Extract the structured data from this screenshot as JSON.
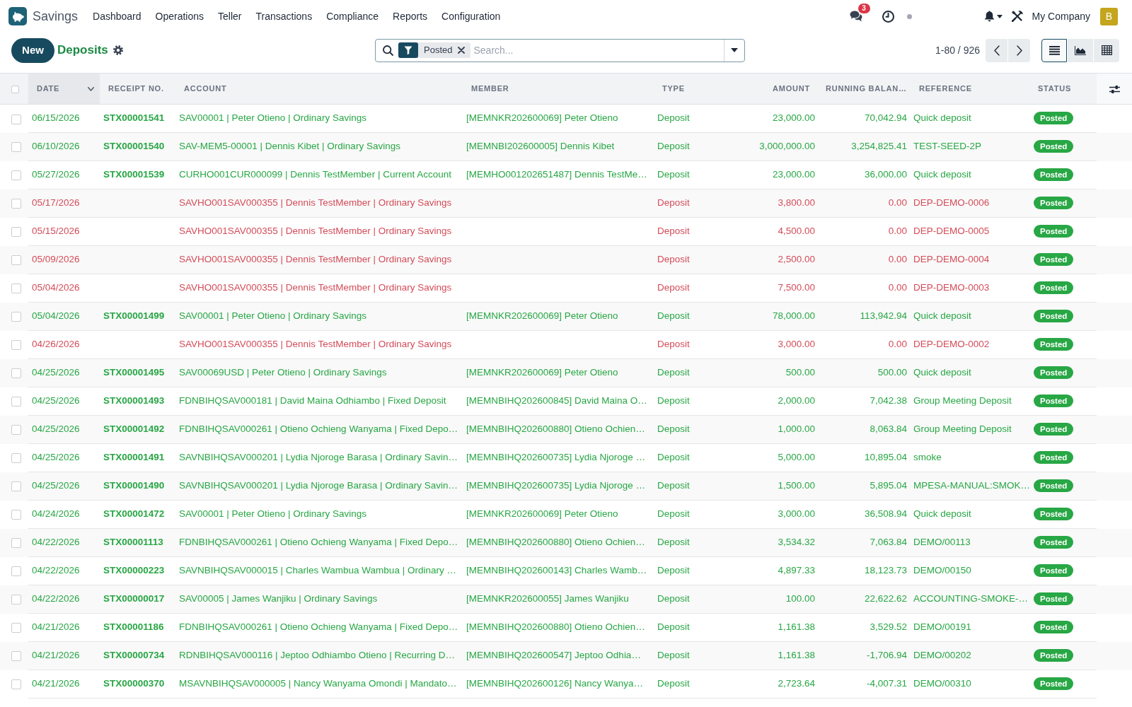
{
  "navbar": {
    "app_name": "Savings",
    "menu": [
      "Dashboard",
      "Operations",
      "Teller",
      "Transactions",
      "Compliance",
      "Reports",
      "Configuration"
    ],
    "messages_count": "3",
    "company": "My Company",
    "avatar_letter": "B"
  },
  "control_panel": {
    "new_button": "New",
    "breadcrumb": "Deposits",
    "search": {
      "facets": [
        {
          "label": "Posted"
        }
      ],
      "placeholder": "Search..."
    },
    "pager": "1-80 / 926",
    "views": [
      {
        "kind": "list",
        "selected": true
      },
      {
        "kind": "graph",
        "selected": false
      },
      {
        "kind": "pivot",
        "selected": false
      }
    ]
  },
  "table": {
    "select_all": {
      "checked": false
    },
    "columns": [
      {
        "label": "DATE",
        "sorted": true
      },
      {
        "label": "RECEIPT NO.",
        "sorted": false
      },
      {
        "label": "ACCOUNT",
        "sorted": false
      },
      {
        "label": "MEMBER",
        "sorted": false
      },
      {
        "label": "TYPE",
        "sorted": false
      },
      {
        "label": "AMOUNT",
        "sorted": false
      },
      {
        "label": "RUNNING BALAN…",
        "sorted": false
      },
      {
        "label": "REFERENCE",
        "sorted": false
      },
      {
        "label": "STATUS",
        "sorted": false
      }
    ],
    "rows": [
      {
        "selected": false,
        "color": "#28a745",
        "date": "06/15/2026",
        "receipt_no": "STX00001541",
        "account": "SAV00001 | Peter Otieno | Ordinary Savings",
        "member": "[MEMNKR202600069] Peter Otieno",
        "type": "Deposit",
        "amount": "23,000.00",
        "running_balance": "70,042.94",
        "reference": "Quick deposit",
        "status": "Posted"
      },
      {
        "selected": false,
        "color": "#28a745",
        "date": "06/10/2026",
        "receipt_no": "STX00001540",
        "account": "SAV-MEM5-00001 | Dennis Kibet | Ordinary Savings",
        "member": "[MEMNBI202600005] Dennis Kibet",
        "type": "Deposit",
        "amount": "3,000,000.00",
        "running_balance": "3,254,825.41",
        "reference": "TEST-SEED-2P",
        "status": "Posted"
      },
      {
        "selected": false,
        "color": "#28a745",
        "date": "05/27/2026",
        "receipt_no": "STX00001539",
        "account": "CURHO001CUR000099 | Dennis TestMember | Current Account",
        "member": "[MEMHO001202651487] Dennis TestMe…",
        "type": "Deposit",
        "amount": "23,000.00",
        "running_balance": "36,000.00",
        "reference": "Quick deposit",
        "status": "Posted"
      },
      {
        "selected": false,
        "color": "#d44c59",
        "date": "05/17/2026",
        "account": "SAVHO001SAV000355 | Dennis TestMember | Ordinary Savings",
        "type": "Deposit",
        "amount": "3,800.00",
        "running_balance": "0.00",
        "reference": "DEP-DEMO-0006",
        "status": "Posted"
      },
      {
        "selected": false,
        "color": "#d44c59",
        "date": "05/15/2026",
        "account": "SAVHO001SAV000355 | Dennis TestMember | Ordinary Savings",
        "type": "Deposit",
        "amount": "4,500.00",
        "running_balance": "0.00",
        "reference": "DEP-DEMO-0005",
        "status": "Posted"
      },
      {
        "selected": false,
        "color": "#d44c59",
        "date": "05/09/2026",
        "account": "SAVHO001SAV000355 | Dennis TestMember | Ordinary Savings",
        "type": "Deposit",
        "amount": "2,500.00",
        "running_balance": "0.00",
        "reference": "DEP-DEMO-0004",
        "status": "Posted"
      },
      {
        "selected": false,
        "color": "#d44c59",
        "date": "05/04/2026",
        "account": "SAVHO001SAV000355 | Dennis TestMember | Ordinary Savings",
        "type": "Deposit",
        "amount": "7,500.00",
        "running_balance": "0.00",
        "reference": "DEP-DEMO-0003",
        "status": "Posted"
      },
      {
        "selected": false,
        "color": "#28a745",
        "date": "05/04/2026",
        "receipt_no": "STX00001499",
        "account": "SAV00001 | Peter Otieno | Ordinary Savings",
        "member": "[MEMNKR202600069] Peter Otieno",
        "type": "Deposit",
        "amount": "78,000.00",
        "running_balance": "113,942.94",
        "reference": "Quick deposit",
        "status": "Posted"
      },
      {
        "selected": false,
        "color": "#d44c59",
        "date": "04/26/2026",
        "account": "SAVHO001SAV000355 | Dennis TestMember | Ordinary Savings",
        "type": "Deposit",
        "amount": "3,000.00",
        "running_balance": "0.00",
        "reference": "DEP-DEMO-0002",
        "status": "Posted"
      },
      {
        "selected": false,
        "color": "#28a745",
        "date": "04/25/2026",
        "receipt_no": "STX00001495",
        "account": "SAV00069USD | Peter Otieno | Ordinary Savings",
        "member": "[MEMNKR202600069] Peter Otieno",
        "type": "Deposit",
        "amount": "500.00",
        "running_balance": "500.00",
        "reference": "Quick deposit",
        "status": "Posted"
      },
      {
        "selected": false,
        "color": "#28a745",
        "date": "04/25/2026",
        "receipt_no": "STX00001493",
        "account": "FDNBIHQSAV000181 | David Maina Odhiambo | Fixed Deposit",
        "member": "[MEMNBIHQ202600845] David Maina O…",
        "type": "Deposit",
        "amount": "2,000.00",
        "running_balance": "7,042.38",
        "reference": "Group Meeting Deposit",
        "status": "Posted"
      },
      {
        "selected": false,
        "color": "#28a745",
        "date": "04/25/2026",
        "receipt_no": "STX00001492",
        "account": "FDNBIHQSAV000261 | Otieno Ochieng Wanyama | Fixed Depo…",
        "member": "[MEMNBIHQ202600880] Otieno Ochien…",
        "type": "Deposit",
        "amount": "1,000.00",
        "running_balance": "8,063.84",
        "reference": "Group Meeting Deposit",
        "status": "Posted"
      },
      {
        "selected": false,
        "color": "#28a745",
        "date": "04/25/2026",
        "receipt_no": "STX00001491",
        "account": "SAVNBIHQSAV000201 | Lydia Njoroge Barasa | Ordinary Savin…",
        "member": "[MEMNBIHQ202600735] Lydia Njoroge …",
        "type": "Deposit",
        "amount": "5,000.00",
        "running_balance": "10,895.04",
        "reference": "smoke",
        "status": "Posted"
      },
      {
        "selected": false,
        "color": "#28a745",
        "date": "04/25/2026",
        "receipt_no": "STX00001490",
        "account": "SAVNBIHQSAV000201 | Lydia Njoroge Barasa | Ordinary Savin…",
        "member": "[MEMNBIHQ202600735] Lydia Njoroge …",
        "type": "Deposit",
        "amount": "1,500.00",
        "running_balance": "5,895.04",
        "reference": "MPESA-MANUAL:SMOK…",
        "status": "Posted"
      },
      {
        "selected": false,
        "color": "#28a745",
        "date": "04/24/2026",
        "receipt_no": "STX00001472",
        "account": "SAV00001 | Peter Otieno | Ordinary Savings",
        "member": "[MEMNKR202600069] Peter Otieno",
        "type": "Deposit",
        "amount": "3,000.00",
        "running_balance": "36,508.94",
        "reference": "Quick deposit",
        "status": "Posted"
      },
      {
        "selected": false,
        "color": "#28a745",
        "date": "04/22/2026",
        "receipt_no": "STX00001113",
        "account": "FDNBIHQSAV000261 | Otieno Ochieng Wanyama | Fixed Depo…",
        "member": "[MEMNBIHQ202600880] Otieno Ochien…",
        "type": "Deposit",
        "amount": "3,534.32",
        "running_balance": "7,063.84",
        "reference": "DEMO/00113",
        "status": "Posted"
      },
      {
        "selected": false,
        "color": "#28a745",
        "date": "04/22/2026",
        "receipt_no": "STX00000223",
        "account": "SAVNBIHQSAV000015 | Charles Wambua Wambua | Ordinary …",
        "member": "[MEMNBIHQ202600143] Charles Wamb…",
        "type": "Deposit",
        "amount": "4,897.33",
        "running_balance": "18,123.73",
        "reference": "DEMO/00150",
        "status": "Posted"
      },
      {
        "selected": false,
        "color": "#28a745",
        "date": "04/22/2026",
        "receipt_no": "STX00000017",
        "account": "SAV00005 | James Wanjiku | Ordinary Savings",
        "member": "[MEMNKR202600055] James Wanjiku",
        "type": "Deposit",
        "amount": "100.00",
        "running_balance": "22,622.62",
        "reference": "ACCOUNTING-SMOKE-…",
        "status": "Posted"
      },
      {
        "selected": false,
        "color": "#28a745",
        "date": "04/21/2026",
        "receipt_no": "STX00001186",
        "account": "FDNBIHQSAV000261 | Otieno Ochieng Wanyama | Fixed Depo…",
        "member": "[MEMNBIHQ202600880] Otieno Ochien…",
        "type": "Deposit",
        "amount": "1,161.38",
        "running_balance": "3,529.52",
        "reference": "DEMO/00191",
        "status": "Posted"
      },
      {
        "selected": false,
        "color": "#28a745",
        "date": "04/21/2026",
        "receipt_no": "STX00000734",
        "account": "RDNBIHQSAV000116 | Jeptoo Odhiambo Otieno | Recurring D…",
        "member": "[MEMNBIHQ202600547] Jeptoo Odhia…",
        "type": "Deposit",
        "amount": "1,161.38",
        "running_balance": "-1,706.94",
        "reference": "DEMO/00202",
        "status": "Posted"
      },
      {
        "selected": false,
        "color": "#28a745",
        "date": "04/21/2026",
        "receipt_no": "STX00000370",
        "account": "MSAVNBIHQSAV000005 | Nancy Wanyama Omondi | Mandato…",
        "member": "[MEMNBIHQ202600126] Nancy Wanya…",
        "type": "Deposit",
        "amount": "2,723.64",
        "running_balance": "-4,007.31",
        "reference": "DEMO/00310",
        "status": "Posted"
      }
    ]
  }
}
